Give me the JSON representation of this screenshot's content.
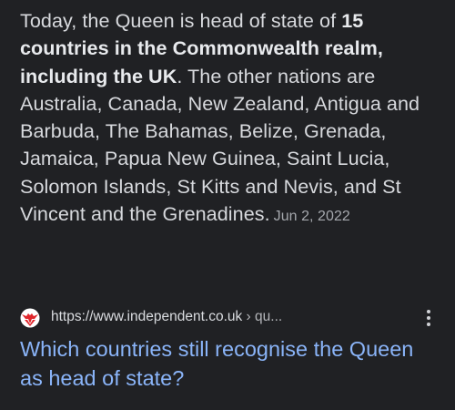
{
  "snippet": {
    "text_before": "Today, the Queen is head of state of ",
    "bold_text": "15 countries in the Commonwealth realm, including the UK",
    "text_after": ". The other nations are Australia, Canada, New Zealand, Antigua and Barbuda, The Bahamas, Belize, Grenada, Jamaica, Papua New Guinea, Saint Lucia, Solomon Islands, St Kitts and Nevis, and St Vincent and the Grenadines.",
    "date": "Jun 2, 2022"
  },
  "result": {
    "url": "https://www.independent.co.uk",
    "url_path": " › qu...",
    "title": "Which countries still recognise the Queen as head of state?",
    "favicon": "independent-eagle-icon",
    "menu_icon": "more-vert-icon"
  },
  "colors": {
    "background": "#202124",
    "text": "#d7d9dd",
    "link": "#8ab4f8",
    "favicon": "#e0262c"
  }
}
